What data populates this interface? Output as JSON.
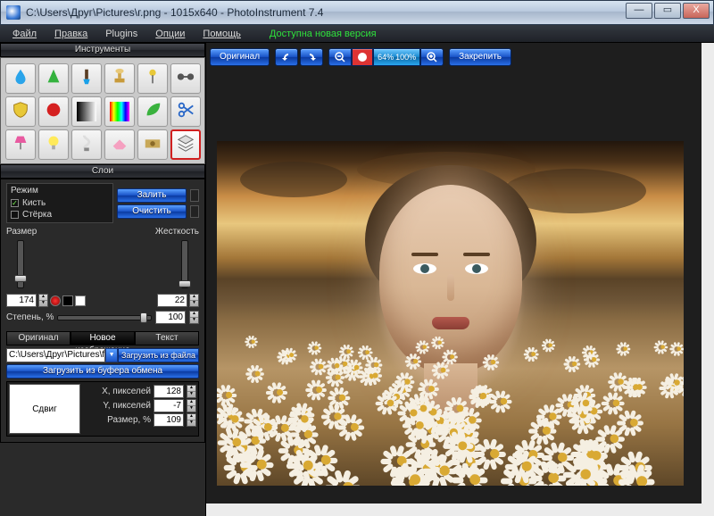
{
  "window": {
    "title": "C:\\Users\\Друг\\Pictures\\г.png - 1015x640 - PhotoInstrument 7.4",
    "min": "—",
    "max": "▭",
    "close": "X"
  },
  "menu": {
    "file": "Файл",
    "edit": "Правка",
    "plugins": "Plugins",
    "options": "Опции",
    "help": "Помощь",
    "update": "Доступна новая версия"
  },
  "panels": {
    "tools": "Инструменты",
    "layers": "Слои"
  },
  "tools_grid": [
    "drop",
    "cone",
    "brush",
    "stamp",
    "pin",
    "dumbbell",
    "shield",
    "red-circle",
    "gradient-bw",
    "gradient-rainbow",
    "leaf",
    "scissors",
    "lamp",
    "bulb",
    "cfl",
    "eraser",
    "money",
    "layers"
  ],
  "tools_selected": "layers",
  "mode": {
    "label": "Режим",
    "brush": "Кисть",
    "brush_checked": true,
    "eraser": "Стёрка",
    "eraser_checked": false,
    "fill": "Залить",
    "clear": "Очистить"
  },
  "size": {
    "label": "Размер",
    "value": "174"
  },
  "hardness": {
    "label": "Жесткость",
    "value": "22"
  },
  "degree": {
    "label": "Степень, %",
    "value": "100"
  },
  "tabs": {
    "original": "Оригинал",
    "newimg": "Новое изображение",
    "text": "Текст",
    "active": "newimg"
  },
  "file": {
    "path": "C:\\Users\\Друг\\Pictures\\foto на ▾",
    "load_file": "Загрузить из файла",
    "load_clip": "Загрузить из буфера обмена"
  },
  "params": {
    "shift": "Сдвиг",
    "x_label": "X, пикселей",
    "x": "128",
    "y_label": "Y, пикселей",
    "y": "-7",
    "size_label": "Размер, %",
    "size": "109"
  },
  "toolbar": {
    "original": "Оригинал",
    "zoom_pct": "64%",
    "zoom_100": "100%",
    "pin": "Закрепить"
  }
}
